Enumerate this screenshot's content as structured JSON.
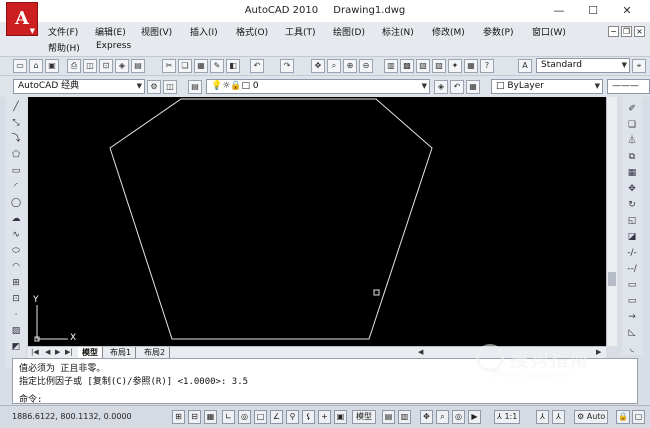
{
  "window": {
    "app_name": "AutoCAD 2010",
    "doc_name": "Drawing1.dwg",
    "minimize": "—",
    "maximize": "☐",
    "close": "✕"
  },
  "menu": {
    "row1": [
      "文件(F)",
      "编辑(E)",
      "视图(V)",
      "插入(I)",
      "格式(O)",
      "工具(T)",
      "绘图(D)",
      "标注(N)",
      "修改(M)",
      "参数(P)",
      "窗口(W)"
    ],
    "row2": [
      "帮助(H)",
      "Express"
    ]
  },
  "toolbar": {
    "text_style": "Standard",
    "workspace": "AutoCAD 经典",
    "layer": "0",
    "color": "ByLayer"
  },
  "ucs": {
    "x_label": "X",
    "y_label": "Y"
  },
  "tabs": {
    "model": "模型",
    "layout1": "布局1",
    "layout2": "布局2"
  },
  "command": {
    "line1": "值必须为 正且非零。",
    "line2": "指定比例因子或 [复制(C)/参照(R)] <1.0000>:  3.5",
    "prompt": "命令:"
  },
  "status": {
    "coordinates": "1886.6122, 800.1132, 0.0000",
    "model_label": "模型",
    "annotation_scale": "1:1",
    "workspace_switch": "Auto"
  },
  "watermark": {
    "text": "搜狗指南",
    "url": "zhinan.sogou.com"
  }
}
